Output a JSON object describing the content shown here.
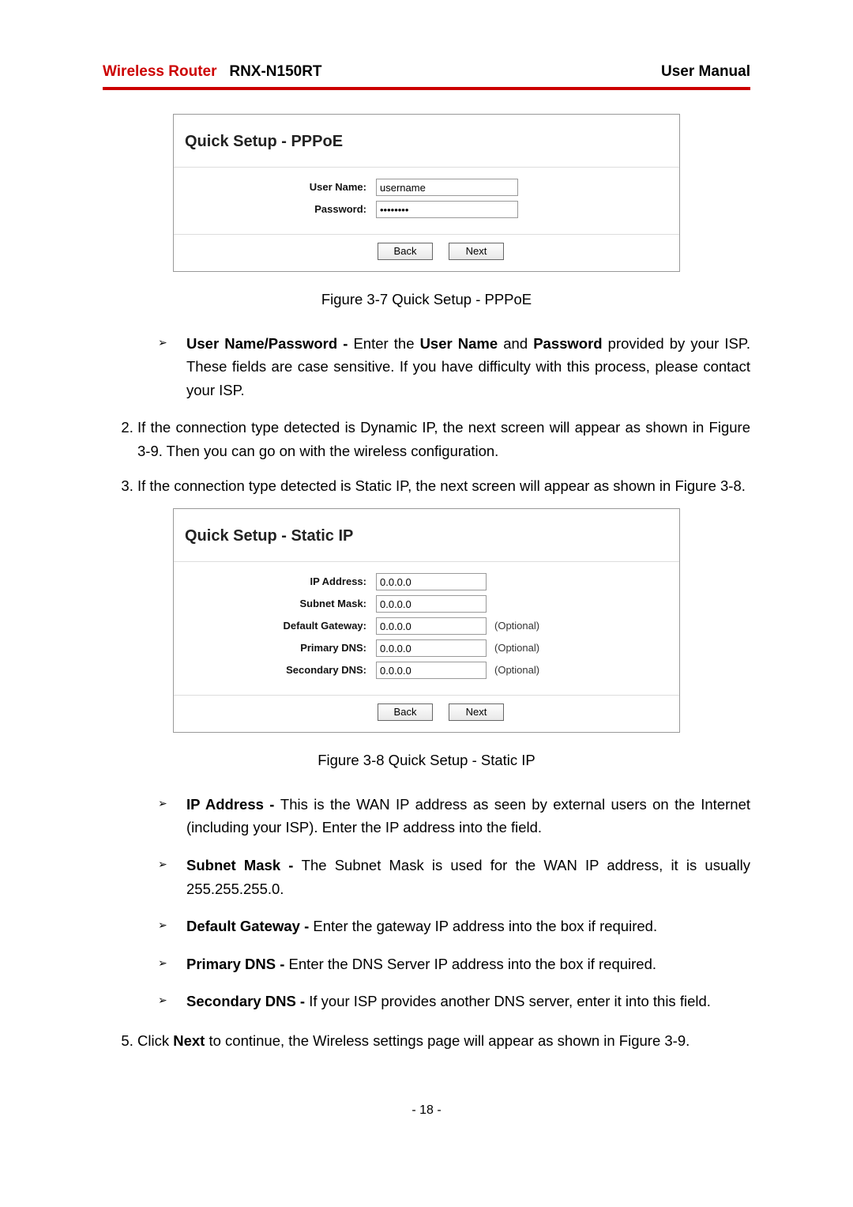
{
  "header": {
    "brand_red": "Wireless Router",
    "model": "RNX-N150RT",
    "manual": "User Manual"
  },
  "pppoe_panel": {
    "title": "Quick Setup - PPPoE",
    "username_label": "User Name:",
    "username_value": "username",
    "password_label": "Password:",
    "password_value": "••••••••",
    "back": "Back",
    "next": "Next"
  },
  "pppoe_caption": "Figure 3-7    Quick Setup - PPPoE",
  "bullet_user_pass": {
    "term": "User Name/Password - ",
    "text_a": "Enter the ",
    "user_name": "User Name",
    "and": " and ",
    "password": "Password",
    "rest": " provided by your ISP. These fields are case sensitive. If you have difficulty with this process, please contact your ISP."
  },
  "step2": "If the connection type detected is Dynamic IP, the next screen will appear as shown in Figure 3-9. Then you can go on with the wireless configuration.",
  "step3": "If the connection type detected is Static IP, the next screen will appear as shown in Figure 3-8.",
  "static_panel": {
    "title": "Quick Setup - Static IP",
    "rows": [
      {
        "label": "IP Address:",
        "value": "0.0.0.0",
        "optional": ""
      },
      {
        "label": "Subnet Mask:",
        "value": "0.0.0.0",
        "optional": ""
      },
      {
        "label": "Default Gateway:",
        "value": "0.0.0.0",
        "optional": "(Optional)"
      },
      {
        "label": "Primary DNS:",
        "value": "0.0.0.0",
        "optional": "(Optional)"
      },
      {
        "label": "Secondary DNS:",
        "value": "0.0.0.0",
        "optional": "(Optional)"
      }
    ],
    "back": "Back",
    "next": "Next"
  },
  "static_caption": "Figure 3-8    Quick Setup - Static IP",
  "bullets2": [
    {
      "term": "IP Address - ",
      "text": "This is the WAN IP address as seen by external users on the Internet (including your ISP). Enter the IP address into the field."
    },
    {
      "term": "Subnet Mask - ",
      "text": "The Subnet Mask is used for the WAN IP address, it is usually 255.255.255.0."
    },
    {
      "term": "Default Gateway - ",
      "text": "Enter the gateway IP address into the box if required."
    },
    {
      "term": "Primary DNS - ",
      "text": "Enter the DNS Server IP address into the box if required."
    },
    {
      "term": "Secondary DNS - ",
      "text": "If your ISP provides another DNS server, enter it into this field."
    }
  ],
  "step5": {
    "pre": "Click ",
    "next": "Next",
    "post": " to continue, the Wireless settings page will appear as shown in Figure 3-9."
  },
  "page_number": "- 18 -"
}
